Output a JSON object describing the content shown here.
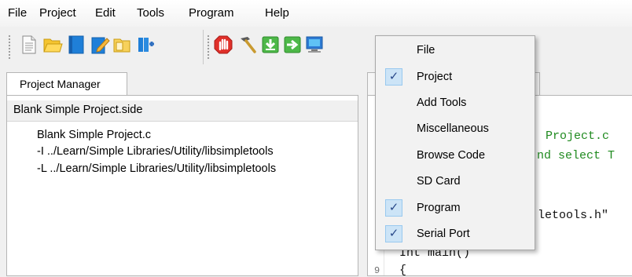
{
  "menubar": {
    "items": [
      {
        "label": "File"
      },
      {
        "label": "Project"
      },
      {
        "label": "Edit"
      },
      {
        "label": "Tools"
      },
      {
        "label": "Program"
      },
      {
        "label": "Help"
      }
    ]
  },
  "toolbar": {
    "buttons": [
      {
        "icon": "new-file-icon"
      },
      {
        "icon": "open-folder-icon"
      },
      {
        "icon": "save-icon"
      },
      {
        "icon": "save-as-icon"
      },
      {
        "icon": "project-folder-icon"
      },
      {
        "icon": "build-library-icon"
      },
      {
        "icon": "stop-hand-icon"
      },
      {
        "icon": "build-hammer-icon"
      },
      {
        "icon": "load-ram-icon"
      },
      {
        "icon": "run-arrow-icon"
      },
      {
        "icon": "terminal-icon"
      }
    ]
  },
  "project_manager": {
    "tab_label": "Project Manager",
    "header": "Blank Simple Project.side",
    "files": [
      "Blank Simple Project.c",
      "-I ../Learn/Simple Libraries/Utility/libsimpletools",
      "-L ../Learn/Simple Libraries/Utility/libsimpletools"
    ]
  },
  "editor": {
    "lines": [
      {
        "text": "Project.c",
        "color": "#1f8a1f"
      },
      {
        "text": "nd select T",
        "color": "#1f8a1f"
      },
      {
        "text": "letools.h\"",
        "color": "#101010"
      },
      {
        "text": "Int main()",
        "color": "#101010"
      },
      {
        "text": "{",
        "color": "#101010"
      }
    ],
    "line_numbers": [
      "9"
    ]
  },
  "dropdown": {
    "items": [
      {
        "label": "File",
        "checked": false
      },
      {
        "label": "Project",
        "checked": true
      },
      {
        "label": "Add Tools",
        "checked": false
      },
      {
        "label": "Miscellaneous",
        "checked": false
      },
      {
        "label": "Browse Code",
        "checked": false
      },
      {
        "label": "SD Card",
        "checked": false
      },
      {
        "label": "Program",
        "checked": true
      },
      {
        "label": "Serial Port",
        "checked": true
      }
    ],
    "check_glyph": "✓"
  },
  "colors": {
    "accent_check_bg": "#cce4f7",
    "comment_green": "#1f8a1f",
    "stop_red": "#e0302a",
    "download_green": "#4db848"
  }
}
